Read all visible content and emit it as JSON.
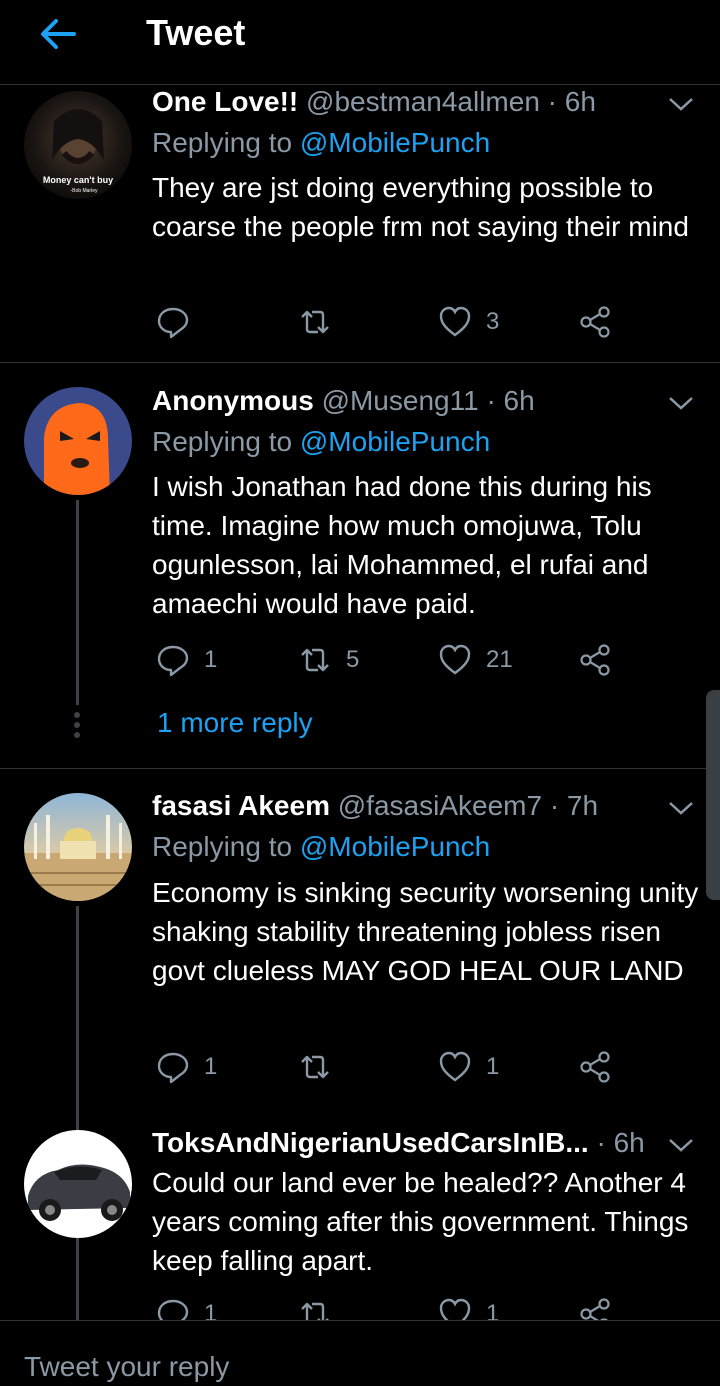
{
  "header": {
    "title": "Tweet",
    "back_icon": "back-arrow-icon",
    "accent": "#1da1f2"
  },
  "tweets": [
    {
      "name": "One Love!!",
      "handle": "@bestman4allmen",
      "time": "· 6h",
      "reply_prefix": "Replying to ",
      "reply_to": "@MobilePunch",
      "text": "They are jst doing everything possible to coarse the people frm not saying their mind",
      "avatar_caption": "Money can't buy",
      "avatar_caption2": "-Bob Marley",
      "replies": "",
      "retweets": "",
      "likes": "3"
    },
    {
      "name": "Anonymous",
      "handle": "@Museng11",
      "time": "· 6h",
      "reply_prefix": "Replying to ",
      "reply_to": "@MobilePunch",
      "text": "I wish Jonathan had done this during his time. Imagine how much omojuwa, Tolu ogunlesson, lai Mohammed, el rufai and amaechi would have paid.",
      "replies": "1",
      "retweets": "5",
      "likes": "21",
      "more_replies": "1 more reply"
    },
    {
      "name": "fasasi Akeem",
      "handle": "@fasasiAkeem7",
      "time": "· 7h",
      "reply_prefix": "Replying to ",
      "reply_to": "@MobilePunch",
      "text": "Economy is sinking security worsening unity shaking stability threatening jobless risen govt clueless MAY GOD HEAL OUR LAND",
      "replies": "1",
      "retweets": "",
      "likes": "1"
    },
    {
      "name": "ToksAndNigerianUsedCarsInIB...",
      "handle": "",
      "time": "· 6h",
      "text": "Could our land ever be healed?? Another 4 years coming after this government. Things keep falling apart.",
      "replies": "1",
      "retweets": "",
      "likes": "1"
    }
  ],
  "compose": {
    "placeholder": "Tweet your reply"
  }
}
